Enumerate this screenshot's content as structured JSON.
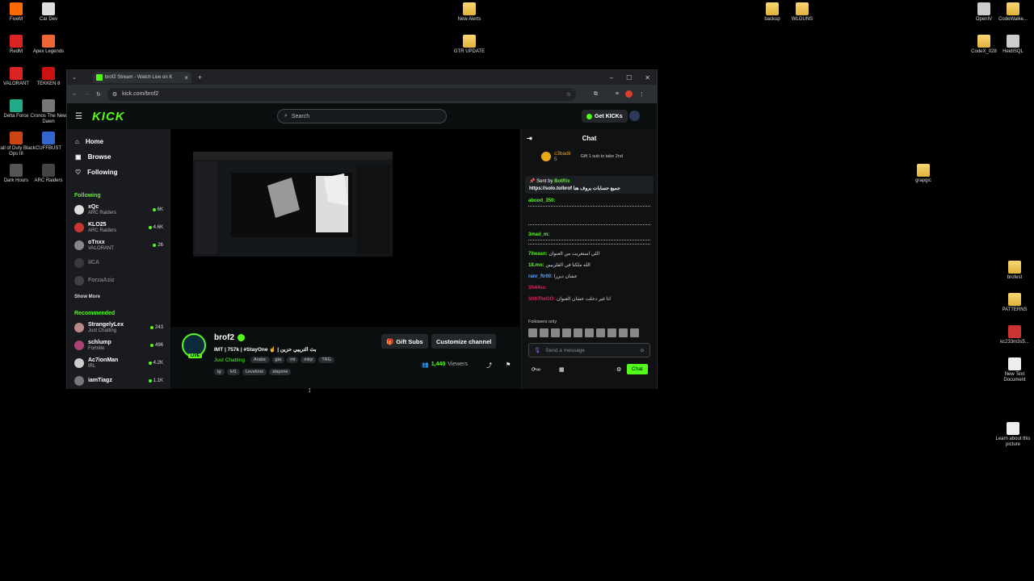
{
  "desktop": {
    "icons_left": [
      "FiveM",
      "Car Dev",
      "RedM",
      "Apex Legends",
      "VALORANT",
      "TEKKEN 8",
      "Delta Force",
      "Cronos The New Dawn",
      "Call of Duty Black Ops III",
      "CUFFBUST",
      "Dark Hours",
      "ARC Raiders"
    ],
    "icons_center": [
      "New Alerts",
      "GTR UPDATE"
    ],
    "icons_top": [
      "backup",
      "WLGUNS",
      "OpenIV",
      "CodeWalke...",
      "CodeX_028",
      "HeidiSQL"
    ],
    "icons_right": [
      "grapgic",
      "brofest",
      "PATTERNS",
      "kc233m3s5...",
      "New Text Document",
      "Learn about this picture"
    ]
  },
  "browser": {
    "tab_title": "brof2 Stream - Watch Live on K",
    "url": "kick.com/brof2",
    "window_controls": [
      "–",
      "☐",
      "✕"
    ]
  },
  "kick": {
    "logo": "KICK",
    "search_placeholder": "Search",
    "get_kicks": "Get KICKs",
    "nav": [
      "Home",
      "Browse",
      "Following"
    ],
    "following_title": "Following",
    "following": [
      {
        "name": "xQc",
        "category": "ARC Raiders",
        "viewers": "6K"
      },
      {
        "name": "KLO25",
        "category": "ARC Raiders",
        "viewers": "4.6K"
      },
      {
        "name": "oTnxx",
        "category": "VALORANT",
        "viewers": "26"
      },
      {
        "name": "iICA",
        "category": "",
        "viewers": ""
      },
      {
        "name": "ForzaAziz",
        "category": "",
        "viewers": ""
      }
    ],
    "show_more": "Show More",
    "recommended_title": "Recommended",
    "recommended": [
      {
        "name": "StrangelyLex",
        "category": "Just Chatting",
        "viewers": "243"
      },
      {
        "name": "schlump",
        "category": "Fortnite",
        "viewers": "496"
      },
      {
        "name": "Ac7ionMan",
        "category": "IRL",
        "viewers": "4.2K"
      },
      {
        "name": "iamTiagz",
        "category": "",
        "viewers": "1.1K"
      }
    ],
    "streamer": {
      "name": "brof2",
      "live_badge": "LIVE",
      "title": "IMT | 757k | #StayOne ☝ | بث الترييي حزين",
      "category": "Just Chatting",
      "tags": [
        "Arabic",
        "gta",
        "mt",
        "mtrp",
        "TRG"
      ],
      "tags2": [
        "tg",
        "lvl1",
        "Levelone",
        "stayone"
      ],
      "viewers": "1,440",
      "viewers_label": "Viewers"
    },
    "gift_subs": "Gift Subs",
    "customize": "Customize channel",
    "chat": {
      "title": "Chat",
      "top_gifter": "c3badii",
      "top_gifter_count": "5",
      "gift_prompt": "Gift 1 sub to take 2nd",
      "pinned_by": "Sent by",
      "pinned_user": "BotRix",
      "pinned_text": "https://solo.to/brof جميع حسابات بروف هنا",
      "messages": [
        {
          "user": "abood_350:",
          "text": ""
        },
        {
          "user": "3mad_m:",
          "text": ""
        },
        {
          "user": "7ilwasn:",
          "text": "اللي استغربت من العنوان"
        },
        {
          "user": "1ILmo:",
          "text": "الله ملكنا في القلزيبين"
        },
        {
          "user": "ranr_ftr00:",
          "text": "عشان ديزرا"
        },
        {
          "user": "Sh44ss:",
          "text": ""
        },
        {
          "user": "ShhTheGO:",
          "text": "انا غير دخلت عشان العنوان"
        }
      ],
      "followers_only": "Followers only",
      "input_placeholder": "Send a message",
      "send": "Chat"
    }
  }
}
